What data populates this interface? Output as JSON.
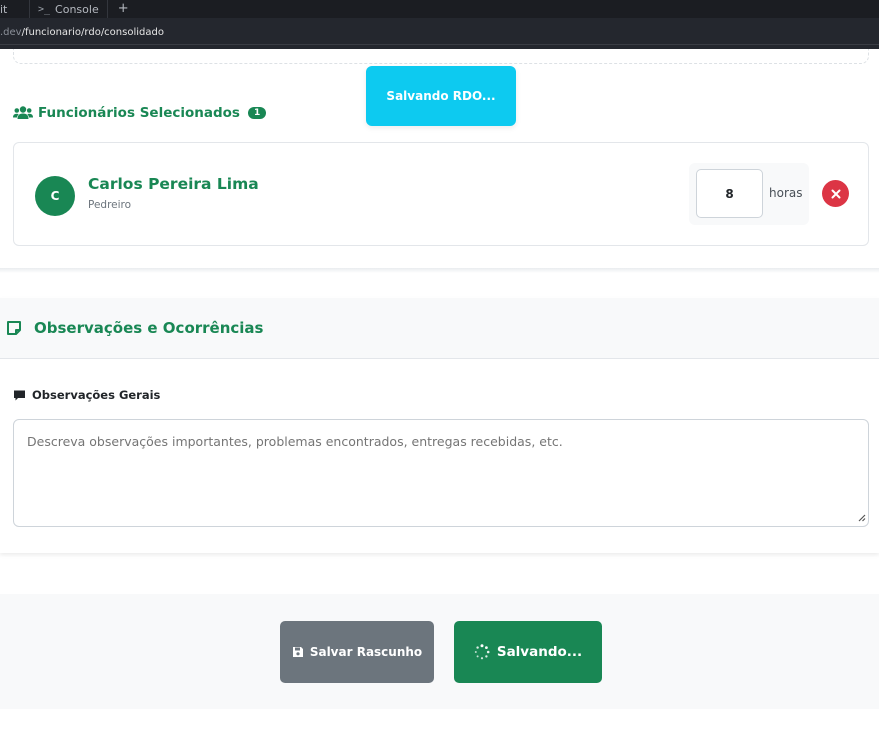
{
  "browser": {
    "tabs": [
      {
        "label": "it"
      },
      {
        "label": "Console",
        "prompt": ">_"
      }
    ],
    "new_tab_symbol": "+",
    "url_prefix": ".dev",
    "url_path": "/funcionario/rdo/consolidado"
  },
  "toast": {
    "text": "Salvando RDO..."
  },
  "selected_employees": {
    "title": "Funcionários Selecionados",
    "count": "1",
    "items": [
      {
        "initial": "C",
        "name": "Carlos Pereira Lima",
        "role": "Pedreiro",
        "hours_value": "8",
        "hours_label": "horas"
      }
    ]
  },
  "observations": {
    "title": "Observações e Ocorrências",
    "general_label": "Observações Gerais",
    "placeholder": "Descreva observações importantes, problemas encontrados, entregas recebidas, etc."
  },
  "footer": {
    "draft_label": "Salvar Rascunho",
    "save_label": "Salvando..."
  },
  "colors": {
    "accent": "#198754",
    "info": "#0dcaf0",
    "danger": "#dc3545",
    "secondary": "#6c757d"
  },
  "icons": {
    "users": "users-icon",
    "note": "sticky-note-icon",
    "comment": "comment-icon",
    "save": "floppy-disk-icon",
    "spinner": "spinner-icon",
    "remove": "close-icon"
  }
}
